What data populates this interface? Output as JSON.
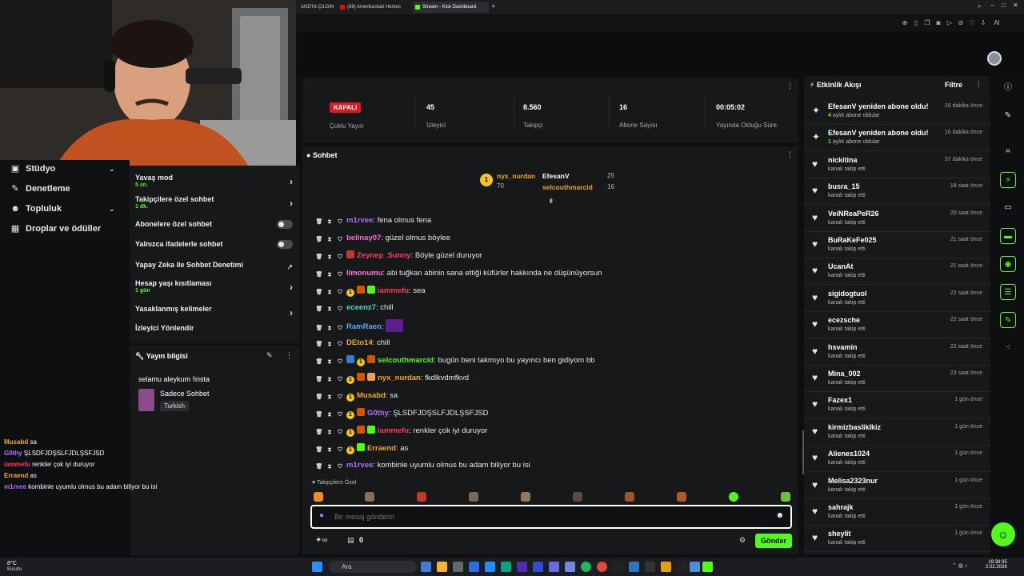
{
  "browser": {
    "tabs": [
      {
        "label": "AND'IN ÇILGIN"
      },
      {
        "label": "(68) Amerika'daki Herkes"
      },
      {
        "label": "Stream - Kick Dashboard"
      }
    ],
    "ai_label": "AI"
  },
  "webcam": {
    "alt": ""
  },
  "nav": {
    "items": [
      {
        "label": "Stüdyo",
        "icon": "camera-icon"
      },
      {
        "label": "Denetleme",
        "icon": "wrench-icon"
      },
      {
        "label": "Topluluk",
        "icon": "users-icon"
      },
      {
        "label": "Droplar ve ödüller",
        "icon": "gift-icon"
      }
    ]
  },
  "settings": {
    "slow_mode": {
      "label": "Yavaş mod",
      "sub": "5 sn."
    },
    "followers_only": {
      "label": "Takipçilere özel sohbet",
      "sub": "1 dk."
    },
    "subscribers_only": {
      "label": "Abonelere özel sohbet"
    },
    "emotes_only": {
      "label": "Yalnızca ifadelerle sohbet"
    },
    "ai_moderation": {
      "label": "Yapay Zeka ile Sohbet Denetimi"
    },
    "account_age": {
      "label": "Hesap yaşı kısıtlaması",
      "sub": "1 gün"
    },
    "banned_words": {
      "label": "Yasaklanmış kelimeler"
    },
    "redirect": {
      "label": "İzleyici Yönlendir"
    }
  },
  "stream_info": {
    "title": "Yayın bilgisi",
    "stream_title": "selamu aleykum !insta",
    "category": "Sadece Sohbet",
    "language": "Turkish"
  },
  "overlay_chat": [
    {
      "user": "Musabd",
      "text": "sa",
      "color": "#f5a623"
    },
    {
      "user": "G0thy",
      "text": "ŞLSDFJDŞSLFJDLŞSFJSD",
      "color": "#b46bff"
    },
    {
      "user": "iammefu",
      "text": "renkler çok iyi duruyor",
      "color": "#ff3b5c"
    },
    {
      "user": "Erraend",
      "text": "as",
      "color": "#f5a623"
    },
    {
      "user": "m1rvee",
      "text": "kombinle uyumlu olmus bu adam biliyor bu isi",
      "color": "#b46bff"
    }
  ],
  "stats": {
    "status": "KAPALI",
    "multistream": "Çoklu Yayın",
    "viewers": {
      "value": "45",
      "label": "İzleyici"
    },
    "followers": {
      "value": "8.560",
      "label": "Takipçi"
    },
    "subscribers": {
      "value": "16",
      "label": "Abone Sayısı"
    },
    "uptime": {
      "value": "00:05:02",
      "label": "Yayında Olduğu Süre"
    }
  },
  "chat": {
    "title": "Sohbet",
    "leaderboard": [
      {
        "user": "nyx_nurdan",
        "count": "70",
        "rank": "1"
      },
      {
        "user": "EfesanV",
        "count": "25"
      },
      {
        "user": "selcouthmarcid",
        "count": "16"
      }
    ],
    "messages": [
      {
        "user": "m1rvee",
        "text": "fena olmus fena",
        "color": "#b46bff",
        "badges": []
      },
      {
        "user": "belinay07",
        "text": "güzel olmus böylee",
        "color": "#ff6bd1",
        "badges": []
      },
      {
        "user": "Zeynep_Sunny",
        "text": "Böyle güzel duruyor",
        "color": "#ff3b5c",
        "badges": [
          "heart"
        ]
      },
      {
        "user": "limonumu",
        "text": "abi tuğkan abinin sana ettiği küfürler hakkında ne düşünüyorsun",
        "color": "#ff7ad9",
        "badges": []
      },
      {
        "user": "iammefu",
        "text": "sea",
        "color": "#ff3b5c",
        "badges": [
          "1",
          "lion",
          "gift"
        ]
      },
      {
        "user": "eceenz7",
        "text": "chill",
        "color": "#2ee6c6",
        "badges": []
      },
      {
        "user": "RamRaen",
        "text": "",
        "color": "#5aa8ff",
        "badges": [],
        "emote": true
      },
      {
        "user": "DEto14",
        "text": "chill",
        "color": "#f5a623",
        "badges": []
      },
      {
        "user": "selcouthmarcid",
        "text": "bugün beni takmıyo bu yayıncı ben gidiyom bb",
        "color": "#53fc18",
        "badges": [
          "sword",
          "1",
          "lion"
        ]
      },
      {
        "user": "nyx_nurdan",
        "text": "fkdlkvdmfkvd",
        "color": "#f5a623",
        "badges": [
          "1",
          "lion",
          "box"
        ]
      },
      {
        "user": "Musabd",
        "text": "sa",
        "color": "#f5a623",
        "badges": [
          "1"
        ]
      },
      {
        "user": "G0thy",
        "text": "ŞLSDFJDŞSLFJDLŞSFJSD",
        "color": "#b46bff",
        "badges": [
          "1",
          "lion"
        ]
      },
      {
        "user": "iammefu",
        "text": "renkler çok iyi duruyor",
        "color": "#ff3b5c",
        "badges": [
          "1",
          "lion",
          "gift"
        ]
      },
      {
        "user": "Erraend",
        "text": "as",
        "color": "#f5a623",
        "badges": [
          "1",
          "gift"
        ]
      },
      {
        "user": "m1rvee",
        "text": "kombinle uyumlu olmus bu adam biliyor bu isi",
        "color": "#b46bff",
        "badges": []
      }
    ],
    "followers_only_label": "Takipçilere Özel",
    "input_placeholder": "Bir mesaj gönderin",
    "points": "0",
    "send_label": "Gönder"
  },
  "feed": {
    "title": "Etkinlik Akışı",
    "filter_label": "Filtre",
    "items": [
      {
        "name": "EfesanV yeniden abone oldu!",
        "months": "4",
        "detail": "aylık abone oldular",
        "time": "16 dakika önce",
        "icon": "sparkle-icon"
      },
      {
        "name": "EfesanV yeniden abone oldu!",
        "months": "1",
        "detail": "aylık abone oldular",
        "time": "16 dakika önce",
        "icon": "sparkle-icon"
      },
      {
        "name": "nickitina",
        "detail": "kanalı takip etti",
        "time": "37 dakika önce",
        "icon": "heart-icon"
      },
      {
        "name": "busra_15",
        "detail": "kanalı takip etti",
        "time": "18 saat önce",
        "icon": "heart-icon"
      },
      {
        "name": "VeiNReaPeR26",
        "detail": "kanalı takip etti",
        "time": "20 saat önce",
        "icon": "heart-icon"
      },
      {
        "name": "BuRaKeFe025",
        "detail": "kanalı takip etti",
        "time": "21 saat önce",
        "icon": "heart-icon"
      },
      {
        "name": "UcanAt",
        "detail": "kanalı takip etti",
        "time": "21 saat önce",
        "icon": "heart-icon"
      },
      {
        "name": "sigidogtuol",
        "detail": "kanalı takip etti",
        "time": "22 saat önce",
        "icon": "heart-icon"
      },
      {
        "name": "ecezsche",
        "detail": "kanalı takip etti",
        "time": "22 saat önce",
        "icon": "heart-icon"
      },
      {
        "name": "hsvamin",
        "detail": "kanalı takip etti",
        "time": "22 saat önce",
        "icon": "heart-icon"
      },
      {
        "name": "Mina_002",
        "detail": "kanalı takip etti",
        "time": "23 saat önce",
        "icon": "heart-icon"
      },
      {
        "name": "Fazex1",
        "detail": "kanalı takip etti",
        "time": "1 gün önce",
        "icon": "heart-icon"
      },
      {
        "name": "kirmizbasliklkiz",
        "detail": "kanalı takip etti",
        "time": "1 gün önce",
        "icon": "heart-icon"
      },
      {
        "name": "Alienes1024",
        "detail": "kanalı takip etti",
        "time": "1 gün önce",
        "icon": "heart-icon"
      },
      {
        "name": "Melisa2323nur",
        "detail": "kanalı takip etti",
        "time": "1 gün önce",
        "icon": "heart-icon"
      },
      {
        "name": "sahrajk",
        "detail": "kanalı takip etti",
        "time": "1 gün önce",
        "icon": "heart-icon"
      },
      {
        "name": "sheylit",
        "detail": "kanalı takip etti",
        "time": "1 gün önce",
        "icon": "heart-icon"
      }
    ]
  },
  "taskbar": {
    "weather_temp": "8°C",
    "weather_text": "Bulutlu",
    "search_label": "Ara",
    "time": "19:38:35",
    "date": "2.02.2026"
  },
  "colors": {
    "accent": "#53fc18",
    "panel": "#17181a",
    "bg": "#0e0f10",
    "live_red": "#e4161b"
  }
}
